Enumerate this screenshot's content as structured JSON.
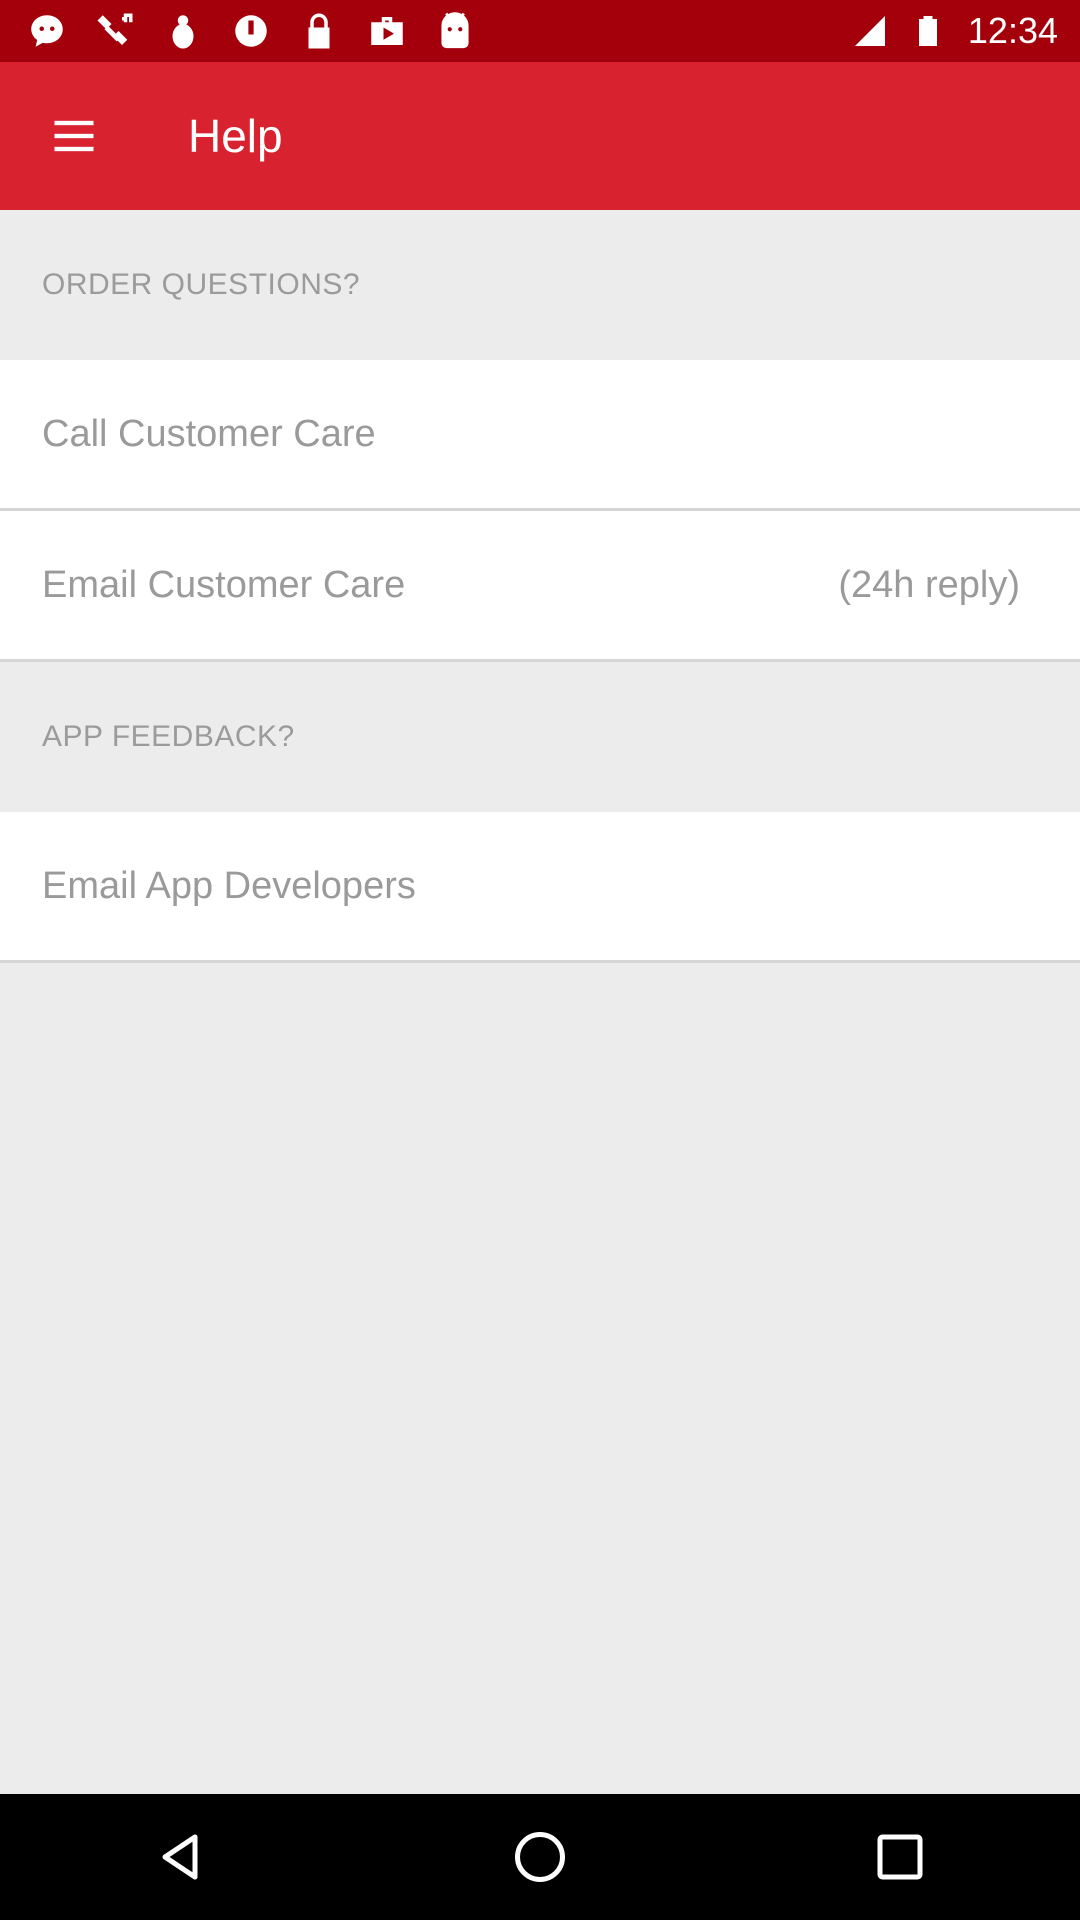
{
  "status_bar": {
    "time": "12:34",
    "icons": [
      "notification-icon",
      "satellite-icon",
      "bug-icon",
      "sync-icon",
      "lock-icon",
      "bag-icon",
      "android-icon",
      "signal-icon",
      "battery-icon"
    ]
  },
  "app_bar": {
    "title": "Help",
    "menu_icon": "hamburger-menu-icon"
  },
  "sections": {
    "order": {
      "header": "ORDER QUESTIONS?",
      "call_label": "Call Customer Care",
      "email_label": "Email Customer Care",
      "email_note": "(24h reply)"
    },
    "feedback": {
      "header": "APP FEEDBACK?",
      "developers_label": "Email App Developers"
    }
  },
  "nav_bar": {
    "back_icon": "back-triangle-icon",
    "home_icon": "home-circle-icon",
    "recents_icon": "recents-square-icon"
  },
  "colors": {
    "status_bar": "#a3000c",
    "app_bar": "#d9222f",
    "background": "#ececec",
    "row_text": "#9a9a9a"
  }
}
